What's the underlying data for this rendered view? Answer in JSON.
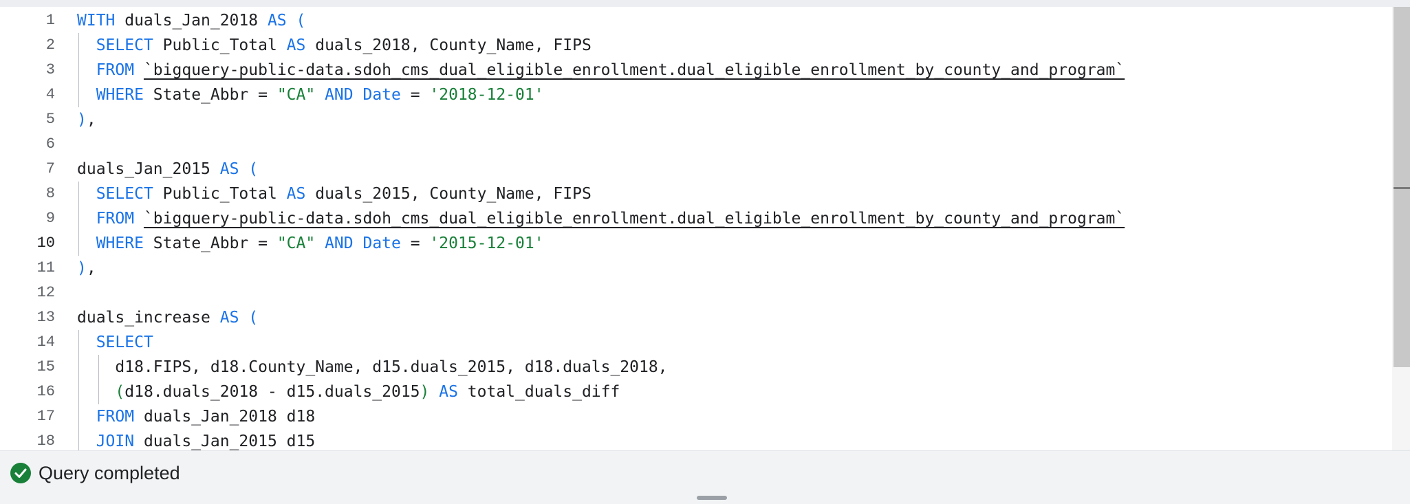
{
  "editor": {
    "active_line": 10,
    "lines": [
      {
        "n": "1",
        "tokens": [
          {
            "t": "WITH",
            "c": "kw"
          },
          {
            "t": " duals_Jan_2018 "
          },
          {
            "t": "AS",
            "c": "kw"
          },
          {
            "t": " "
          },
          {
            "t": "(",
            "c": "kw"
          }
        ]
      },
      {
        "n": "2",
        "tokens": [
          {
            "t": "  "
          },
          {
            "t": "SELECT",
            "c": "kw"
          },
          {
            "t": " Public_Total "
          },
          {
            "t": "AS",
            "c": "kw"
          },
          {
            "t": " duals_2018, County_Name, FIPS"
          }
        ]
      },
      {
        "n": "3",
        "tokens": [
          {
            "t": "  "
          },
          {
            "t": "FROM",
            "c": "kw"
          },
          {
            "t": " "
          },
          {
            "t": "`bigquery-public-data.sdoh_cms_dual_eligible_enrollment.dual_eligible_enrollment_by_county_and_program`",
            "c": "bt"
          }
        ]
      },
      {
        "n": "4",
        "tokens": [
          {
            "t": "  "
          },
          {
            "t": "WHERE",
            "c": "kw"
          },
          {
            "t": " State_Abbr = "
          },
          {
            "t": "\"CA\"",
            "c": "str"
          },
          {
            "t": " "
          },
          {
            "t": "AND",
            "c": "kw"
          },
          {
            "t": " "
          },
          {
            "t": "Date",
            "c": "kw"
          },
          {
            "t": " = "
          },
          {
            "t": "'2018-12-01'",
            "c": "str"
          }
        ]
      },
      {
        "n": "5",
        "tokens": [
          {
            "t": ")",
            "c": "kw"
          },
          {
            "t": ","
          }
        ]
      },
      {
        "n": "6",
        "tokens": []
      },
      {
        "n": "7",
        "tokens": [
          {
            "t": "duals_Jan_2015 "
          },
          {
            "t": "AS",
            "c": "kw"
          },
          {
            "t": " "
          },
          {
            "t": "(",
            "c": "kw"
          }
        ]
      },
      {
        "n": "8",
        "tokens": [
          {
            "t": "  "
          },
          {
            "t": "SELECT",
            "c": "kw"
          },
          {
            "t": " Public_Total "
          },
          {
            "t": "AS",
            "c": "kw"
          },
          {
            "t": " duals_2015, County_Name, FIPS"
          }
        ]
      },
      {
        "n": "9",
        "tokens": [
          {
            "t": "  "
          },
          {
            "t": "FROM",
            "c": "kw"
          },
          {
            "t": " "
          },
          {
            "t": "`bigquery-public-data.sdoh_cms_dual_eligible_enrollment.dual_eligible_enrollment_by_county_and_program`",
            "c": "bt"
          }
        ]
      },
      {
        "n": "10",
        "tokens": [
          {
            "t": "  "
          },
          {
            "t": "WHERE",
            "c": "kw"
          },
          {
            "t": " State_Abbr = "
          },
          {
            "t": "\"CA\"",
            "c": "str"
          },
          {
            "t": " "
          },
          {
            "t": "AND",
            "c": "kw"
          },
          {
            "t": " "
          },
          {
            "t": "Date",
            "c": "kw"
          },
          {
            "t": " = "
          },
          {
            "t": "'2015-12-01'",
            "c": "str"
          }
        ]
      },
      {
        "n": "11",
        "tokens": [
          {
            "t": ")",
            "c": "kw"
          },
          {
            "t": ","
          }
        ]
      },
      {
        "n": "12",
        "tokens": []
      },
      {
        "n": "13",
        "tokens": [
          {
            "t": "duals_increase "
          },
          {
            "t": "AS",
            "c": "kw"
          },
          {
            "t": " "
          },
          {
            "t": "(",
            "c": "kw"
          }
        ]
      },
      {
        "n": "14",
        "tokens": [
          {
            "t": "  "
          },
          {
            "t": "SELECT",
            "c": "kw"
          }
        ]
      },
      {
        "n": "15",
        "tokens": [
          {
            "t": "    d18.FIPS, d18.County_Name, d15.duals_2015, d18.duals_2018,"
          }
        ]
      },
      {
        "n": "16",
        "tokens": [
          {
            "t": "    "
          },
          {
            "t": "(",
            "c": "str"
          },
          {
            "t": "d18.duals_2018 - d15.duals_2015"
          },
          {
            "t": ")",
            "c": "str"
          },
          {
            "t": " "
          },
          {
            "t": "AS",
            "c": "kw"
          },
          {
            "t": " total_duals_diff"
          }
        ]
      },
      {
        "n": "17",
        "tokens": [
          {
            "t": "  "
          },
          {
            "t": "FROM",
            "c": "kw"
          },
          {
            "t": " duals_Jan_2018 d18"
          }
        ]
      },
      {
        "n": "18",
        "tokens": [
          {
            "t": "  "
          },
          {
            "t": "JOIN",
            "c": "kw"
          },
          {
            "t": " duals_Jan_2015 d15"
          }
        ]
      }
    ]
  },
  "status": {
    "text": "Query completed",
    "icon": "check-circle-icon",
    "color": "#188038"
  },
  "colors": {
    "keyword": "#1a73e8",
    "string": "#188038",
    "text": "#202124",
    "line_number": "#5f6368"
  }
}
